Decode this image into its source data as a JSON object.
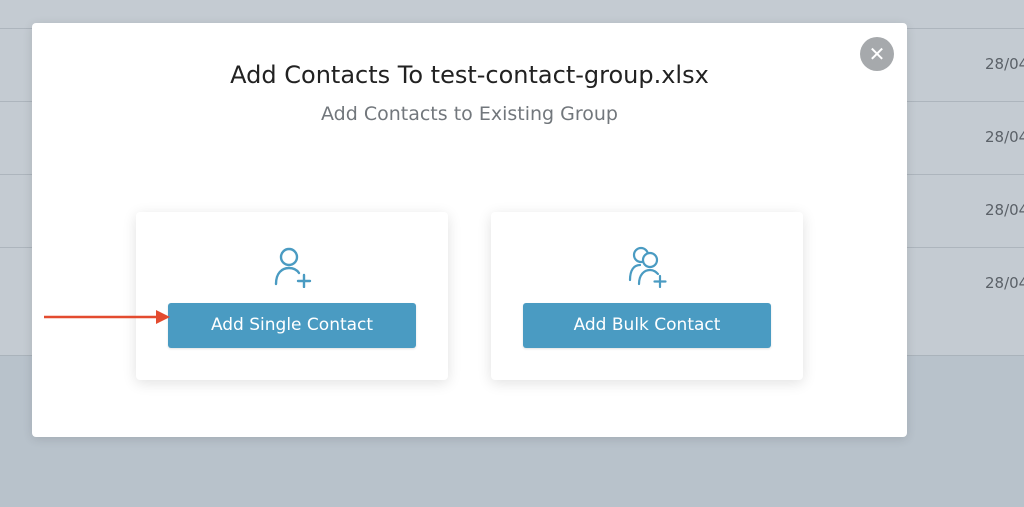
{
  "background": {
    "dates": [
      "28/04",
      "28/04",
      "28/04",
      "28/04"
    ]
  },
  "modal": {
    "title": "Add Contacts To test-contact-group.xlsx",
    "subtitle": "Add Contacts to Existing Group",
    "close_icon": "close-icon",
    "options": [
      {
        "button_label": "Add Single Contact",
        "icon": "user-add-icon"
      },
      {
        "button_label": "Add Bulk Contact",
        "icon": "users-add-icon"
      }
    ]
  },
  "colors": {
    "accent": "#4a9bc2",
    "annotation_arrow": "#e34b2f",
    "overlay": "#c4cbd2"
  }
}
